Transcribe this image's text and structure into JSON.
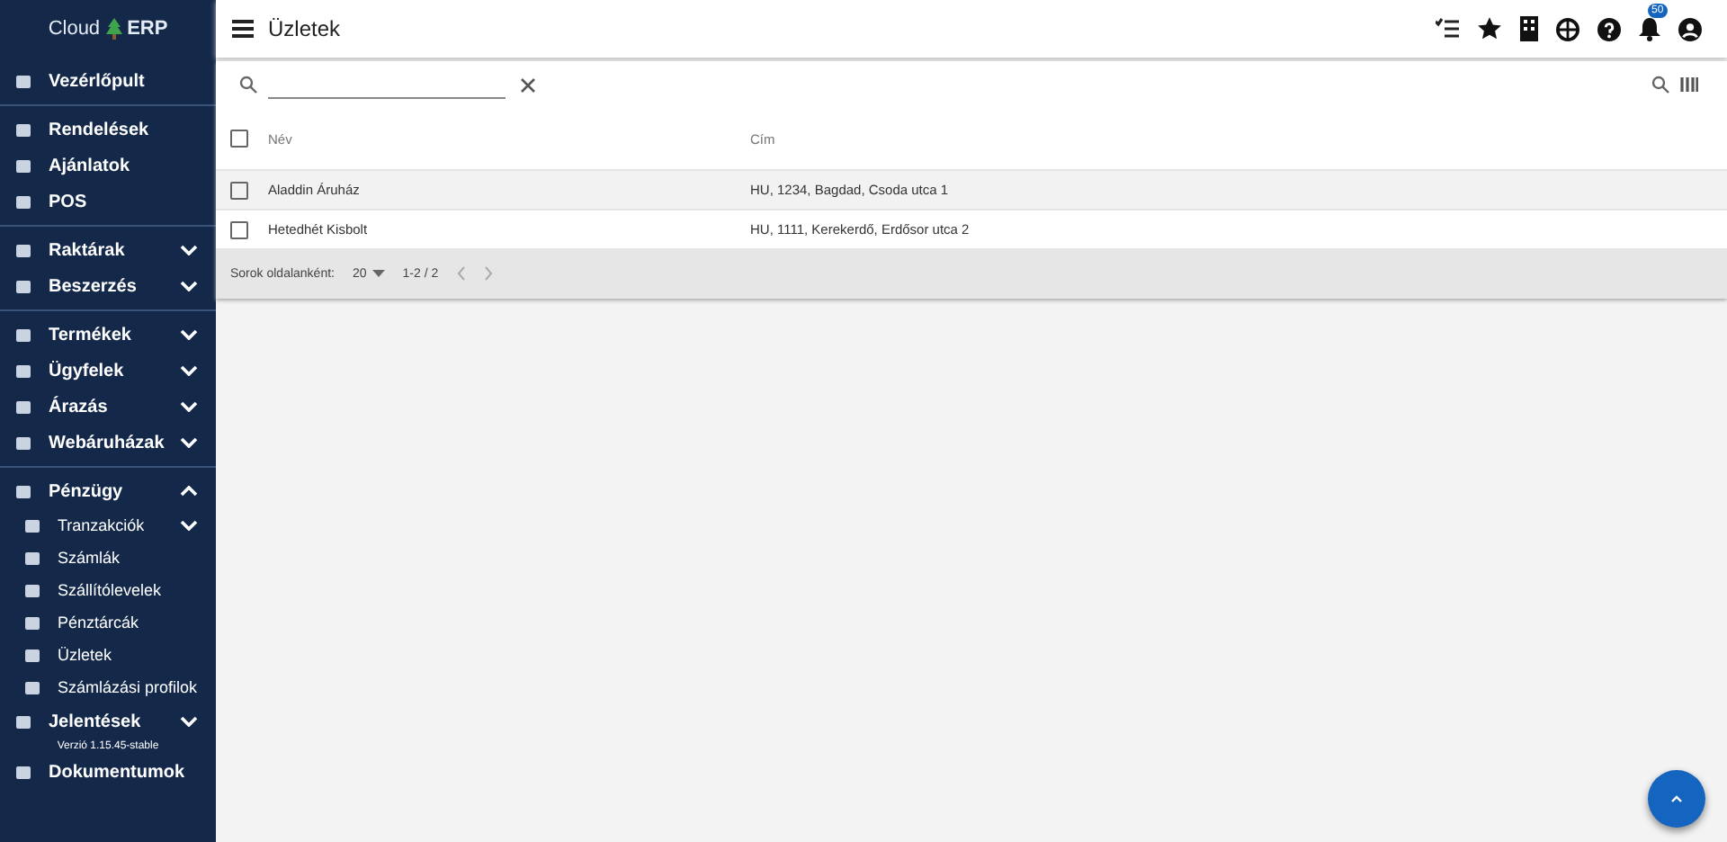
{
  "brand": {
    "left": "Cloud",
    "right": "ERP"
  },
  "sidebar": {
    "sections": [
      {
        "items": [
          {
            "label": "Vezérlőpult",
            "kind": "top"
          }
        ]
      },
      {
        "items": [
          {
            "label": "Rendelések",
            "kind": "top"
          },
          {
            "label": "Ajánlatok",
            "kind": "top"
          },
          {
            "label": "POS",
            "kind": "top"
          }
        ]
      },
      {
        "items": [
          {
            "label": "Raktárak",
            "kind": "group",
            "expanded": false
          },
          {
            "label": "Beszerzés",
            "kind": "group",
            "expanded": false
          }
        ]
      },
      {
        "items": [
          {
            "label": "Termékek",
            "kind": "group",
            "expanded": false
          },
          {
            "label": "Ügyfelek",
            "kind": "group",
            "expanded": false
          },
          {
            "label": "Árazás",
            "kind": "group",
            "expanded": false
          },
          {
            "label": "Webáruházak",
            "kind": "group",
            "expanded": false
          }
        ]
      },
      {
        "items": [
          {
            "label": "Pénzügy",
            "kind": "group",
            "expanded": true
          },
          {
            "label": "Tranzakciók",
            "kind": "subgroup",
            "expanded": false
          },
          {
            "label": "Számlák",
            "kind": "sub"
          },
          {
            "label": "Szállítólevelek",
            "kind": "sub"
          },
          {
            "label": "Pénztárcák",
            "kind": "sub"
          },
          {
            "label": "Üzletek",
            "kind": "sub"
          },
          {
            "label": "Számlázási profilok",
            "kind": "sub"
          },
          {
            "label": "Jelentések",
            "kind": "group",
            "expanded": false
          },
          {
            "label": "Dokumentumok",
            "kind": "group"
          }
        ]
      }
    ],
    "version": "Verzió 1.15.45-stable"
  },
  "header": {
    "title": "Üzletek",
    "notifications": "50"
  },
  "table": {
    "columns": [
      "Név",
      "Cím"
    ],
    "all_checked": false,
    "rows": [
      {
        "cells": [
          "Aladdin Áruház",
          "HU, 1234, Bagdad, Csoda utca 1"
        ],
        "checked": false
      },
      {
        "cells": [
          "Hetedhét Kisbolt",
          "HU, 1111, Kerekerdő, Erdősor utca 2"
        ],
        "checked": false
      }
    ],
    "footer": {
      "rows_label": "Sorok oldalanként:",
      "rows_per_page": "20",
      "range": "1-2 / 2"
    }
  }
}
